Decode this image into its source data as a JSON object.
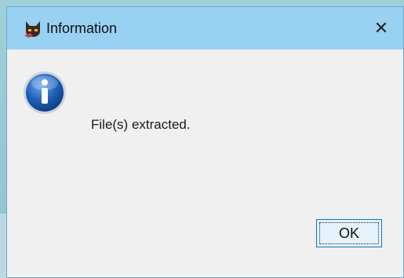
{
  "dialog": {
    "title": "Information",
    "message": "File(s) extracted.",
    "ok_label": "OK",
    "close_glyph": "✕"
  },
  "icons": {
    "app": "cat-app-icon",
    "info": "info-icon",
    "close": "close-icon"
  },
  "colors": {
    "titlebar": "#99d1f3",
    "body": "#f0f0f0",
    "button_border": "#0078d7",
    "info_blue": "#1f5fb8"
  }
}
